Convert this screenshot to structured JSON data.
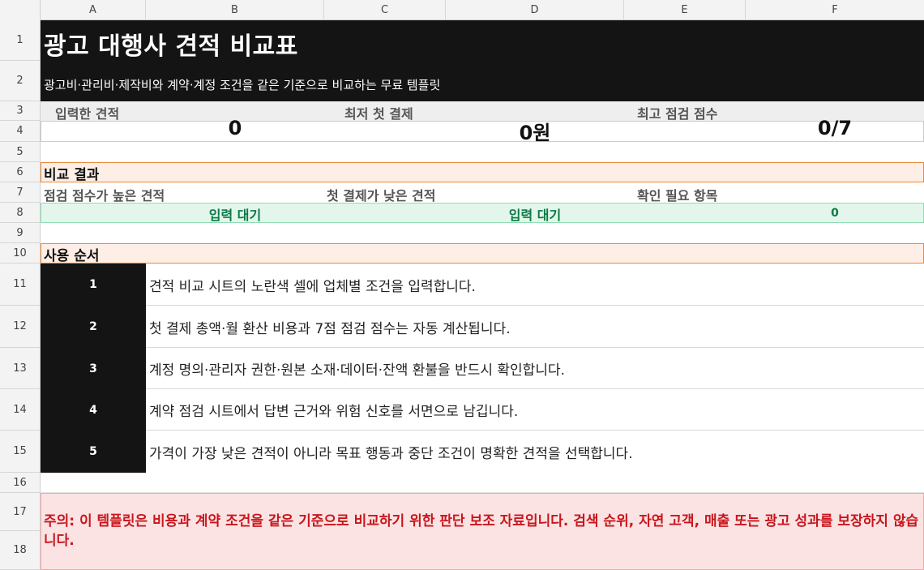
{
  "sheet": {
    "columns": [
      "A",
      "B",
      "C",
      "D",
      "E",
      "F"
    ],
    "rows": [
      "1",
      "2",
      "3",
      "4",
      "5",
      "6",
      "7",
      "8",
      "9",
      "10",
      "11",
      "12",
      "13",
      "14",
      "15",
      "16",
      "17",
      "18"
    ]
  },
  "header": {
    "title": "광고 대행사 견적 비교표",
    "subtitle": "광고비·관리비·제작비와 계약·계정 조건을 같은 기준으로 비교하는 무료 템플릿"
  },
  "metrics": {
    "labels": [
      "입력한 견적",
      "최저 첫 결제",
      "최고 점검 점수"
    ],
    "values": [
      "0",
      "0원",
      "0/7"
    ]
  },
  "results": {
    "section_title": "비교 결과",
    "labels": [
      "점검 점수가 높은 견적",
      "첫 결제가 낮은 견적",
      "확인 필요 항목"
    ],
    "values": [
      "입력 대기",
      "입력 대기",
      "0"
    ]
  },
  "usage": {
    "section_title": "사용 순서",
    "steps": [
      {
        "num": "1",
        "text": "견적 비교 시트의 노란색 셀에 업체별 조건을 입력합니다."
      },
      {
        "num": "2",
        "text": "첫 결제 총액·월 환산 비용과 7점 점검 점수는 자동 계산됩니다."
      },
      {
        "num": "3",
        "text": "계정 명의·관리자 권한·원본 소재·데이터·잔액 환불을 반드시 확인합니다."
      },
      {
        "num": "4",
        "text": "계약 점검 시트에서 답변 근거와 위험 신호를 서면으로 남깁니다."
      },
      {
        "num": "5",
        "text": "가격이 가장 낮은 견적이 아니라 목표 행동과 중단 조건이 명확한 견적을 선택합니다."
      }
    ]
  },
  "warning": {
    "text": "주의: 이 템플릿은 비용과 계약 조건을 같은 기준으로 비교하기 위한 판단 보조 자료입니다. 검색 순위, 자연 고객, 매출 또는 광고 성과를 보장하지 않습니다."
  },
  "colors": {
    "title_band": "#141414",
    "section_band": "#fdeee6",
    "section_border": "#e8893a",
    "result_band": "#e3f6ec",
    "result_text": "#0b7a45",
    "warning_band": "#fbe3e3",
    "warning_text": "#c8161d"
  }
}
